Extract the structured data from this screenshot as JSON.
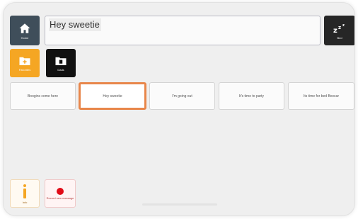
{
  "toolbar": {
    "home_label": "Home",
    "sleep_label": "Bed"
  },
  "message": {
    "text": "Hey sweetie"
  },
  "folders": [
    {
      "label": "Favorites",
      "color": "#f5a623",
      "icon": "folder-plus-icon"
    },
    {
      "label": "Dads",
      "color": "#111111",
      "icon": "folder-icon"
    }
  ],
  "phrases": [
    {
      "label": "Boogins come here"
    },
    {
      "label": "Hey sweetie",
      "selected": true
    },
    {
      "label": "I'm going out"
    },
    {
      "label": "It's time to party"
    },
    {
      "label": "Its time for bed Boxcar"
    }
  ],
  "bottom": {
    "info_label": "Info",
    "record_label": "Record new message",
    "record_color": "#e10b17"
  }
}
